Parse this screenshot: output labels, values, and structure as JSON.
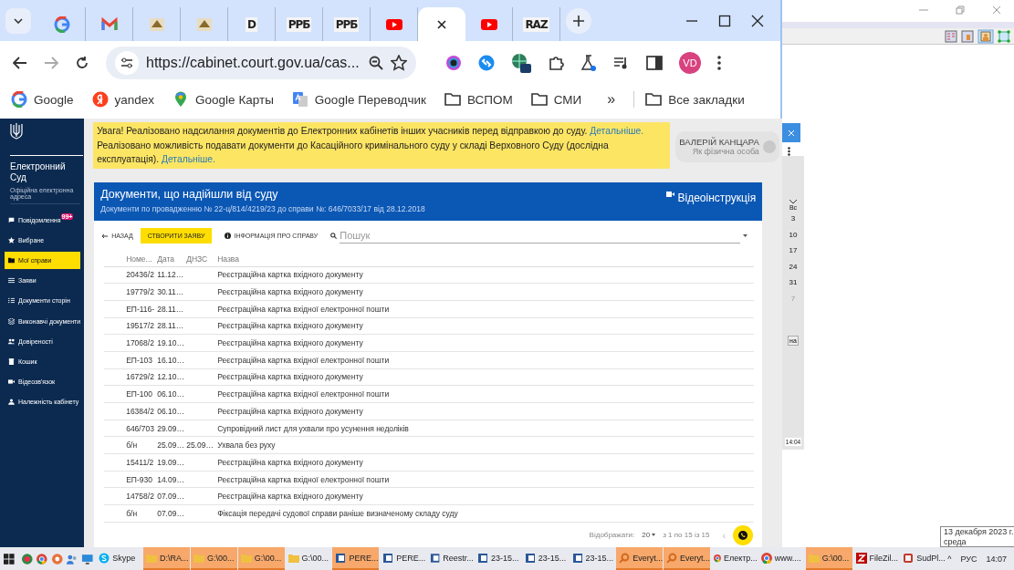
{
  "browser": {
    "tabs": [
      {
        "kind": "google",
        "selected": false
      },
      {
        "kind": "gmail",
        "selected": false
      },
      {
        "kind": "pma",
        "selected": false
      },
      {
        "kind": "pma",
        "selected": false
      },
      {
        "kind": "letter",
        "favicon_text": "D",
        "selected": false
      },
      {
        "kind": "letter",
        "favicon_text": "РРБ",
        "selected": false
      },
      {
        "kind": "letter",
        "favicon_text": "РРБ",
        "selected": false
      },
      {
        "kind": "youtube",
        "selected": false
      },
      {
        "kind": "blank",
        "selected": true
      },
      {
        "kind": "youtube",
        "selected": false
      },
      {
        "kind": "letter",
        "favicon_text": "RAZ",
        "selected": false
      }
    ],
    "address": "https://cabinet.court.gov.ua/cas...",
    "profile": "VD",
    "bookmarks": [
      {
        "kind": "google",
        "label": "Google"
      },
      {
        "kind": "yandex",
        "label": "yandex"
      },
      {
        "kind": "maps",
        "label": "Google Карты"
      },
      {
        "kind": "translate",
        "label": "Google Переводчик"
      },
      {
        "kind": "folder",
        "label": "ВСПОМ"
      },
      {
        "kind": "folder",
        "label": "СМИ"
      }
    ],
    "overflow": "»",
    "all_bookmarks": "Все закладки"
  },
  "sidebar": {
    "title": "Електронний Суд",
    "subtitle": "Офіційна електронна адреса",
    "items": [
      {
        "kind": "chat",
        "label": "Повідомлення",
        "badge": "99+",
        "selected": false
      },
      {
        "kind": "star",
        "label": "Вибране",
        "selected": false
      },
      {
        "kind": "folder",
        "label": "Мої справи",
        "selected": true
      },
      {
        "kind": "list",
        "label": "Заяви",
        "selected": false
      },
      {
        "kind": "checklist",
        "label": "Документи сторін",
        "selected": false
      },
      {
        "kind": "stack",
        "label": "Виконавчі документи",
        "selected": false
      },
      {
        "kind": "people",
        "label": "Довіреності",
        "selected": false
      },
      {
        "kind": "trash",
        "label": "Кошик",
        "selected": false
      },
      {
        "kind": "video",
        "label": "Відеозв'язок",
        "selected": false
      },
      {
        "kind": "person",
        "label": "Належність кабінету",
        "selected": false
      }
    ]
  },
  "notice": {
    "lines": [
      {
        "text": "Увага! Реалізовано надсилання документів до Електронних кабінетів інших учасників перед відправкою до суду.",
        "link": "Детальніше."
      },
      {
        "text": "Реалізовано можливість подавати документи до Касаційного кримінального суду у складі Верховного Суду (дослідна експлуатація).",
        "link": "Детальніше."
      }
    ]
  },
  "user": {
    "name": "ВАЛЕРІЙ КАНЦАРА",
    "role": "Як фізична особа"
  },
  "card": {
    "title": "Документи, що надійшли від суду",
    "subtitle": "Документи по провадженню № 22-ц/814/4219/23 до справи №: 646/7033/17 від 28.12.2018",
    "video_link": "Відеоінструкція",
    "back": "НАЗАД",
    "create": "СТВОРИТИ ЗАЯВУ",
    "info": "ІНФОРМАЦІЯ ПРО СПРАВУ",
    "search": {
      "placeholder": "Пошук"
    }
  },
  "table": {
    "columns": [
      "Номе...",
      "Дата",
      "ДНЗС",
      "Назва"
    ],
    "rows": [
      [
        "20436/2",
        "11.12…",
        "",
        "Реєстраційна картка вхідного документу"
      ],
      [
        "19779/2",
        "30.11…",
        "",
        "Реєстраційна картка вхідного документу"
      ],
      [
        "ЕП-116-",
        "28.11…",
        "",
        "Реєстраційна картка вхідної електронної пошти"
      ],
      [
        "19517/2",
        "28.11…",
        "",
        "Реєстраційна картка вхідного документу"
      ],
      [
        "17068/2",
        "19.10…",
        "",
        "Реєстраційна картка вхідного документу"
      ],
      [
        "ЕП-103",
        "16.10…",
        "",
        "Реєстраційна картка вхідної електронної пошти"
      ],
      [
        "16729/2",
        "12.10…",
        "",
        "Реєстраційна картка вхідного документу"
      ],
      [
        "ЕП-100",
        "06.10…",
        "",
        "Реєстраційна картка вхідної електронної пошти"
      ],
      [
        "16384/2",
        "06.10…",
        "",
        "Реєстраційна картка вхідного документу"
      ],
      [
        "646/703",
        "29.09…",
        "",
        "Супровідний лист для ухвали про усунення недоліків"
      ],
      [
        "б/н",
        "25.09…",
        "25.09…",
        "Ухвала без руху"
      ],
      [
        "15411/2",
        "19.09…",
        "",
        "Реєстраційна картка вхідного документу"
      ],
      [
        "ЕП-930",
        "14.09…",
        "",
        "Реєстраційна картка вхідної електронної пошти"
      ],
      [
        "14758/2",
        "07.09…",
        "",
        "Реєстраційна картка вхідного документу"
      ],
      [
        "б/н",
        "07.09…",
        "",
        "Фіксація передачі судової справи раніше визначеному складу суду"
      ]
    ]
  },
  "pagination": {
    "label": "Відображати:",
    "per_page": "20",
    "range": "з 1 по 15 із 15",
    "prev": "‹"
  },
  "side_app": {
    "calendar_header": "Вс",
    "days": [
      {
        "text": "3",
        "muted": false
      },
      {
        "text": "10",
        "muted": false
      },
      {
        "text": "17",
        "muted": false
      },
      {
        "text": "24",
        "muted": false
      },
      {
        "text": "31",
        "muted": false
      },
      {
        "text": "7",
        "muted": true
      }
    ],
    "button": "на",
    "time": "14:04"
  },
  "taskbar": {
    "items": [
      {
        "kind": "skype",
        "label": "Skype",
        "highlighted": false
      },
      {
        "kind": "folder",
        "label": "D:\\RA...",
        "highlighted": true
      },
      {
        "kind": "folder",
        "label": "G:\\00...",
        "highlighted": true
      },
      {
        "kind": "folder",
        "label": "G:\\00...",
        "highlighted": true
      },
      {
        "kind": "folder",
        "label": "G:\\00...",
        "highlighted": false
      },
      {
        "kind": "doc",
        "label": "PERE...",
        "highlighted": true
      },
      {
        "kind": "doc",
        "label": "PERE...",
        "highlighted": false
      },
      {
        "kind": "doc",
        "label": "Reestr...",
        "highlighted": false
      },
      {
        "kind": "doc",
        "label": "23-15...",
        "highlighted": false
      },
      {
        "kind": "doc",
        "label": "23-15...",
        "highlighted": false
      },
      {
        "kind": "doc",
        "label": "23-15...",
        "highlighted": false
      },
      {
        "kind": "search",
        "label": "Everyt...",
        "highlighted": true
      },
      {
        "kind": "search",
        "label": "Everyt...",
        "highlighted": true
      },
      {
        "kind": "chrome",
        "label": "Електр...",
        "highlighted": false
      },
      {
        "kind": "chrome",
        "label": "www....",
        "highlighted": false
      },
      {
        "kind": "folder",
        "label": "G:\\00...",
        "highlighted": true
      },
      {
        "kind": "filezilla",
        "label": "FileZil...",
        "highlighted": false
      },
      {
        "kind": "app",
        "label": "SudPl...",
        "highlighted": false
      }
    ],
    "tray_caret": "^",
    "language": "РУС",
    "clock": "14:07"
  },
  "tooltip": {
    "lines": [
      "13 декабря 2023 г.",
      "среда"
    ]
  }
}
